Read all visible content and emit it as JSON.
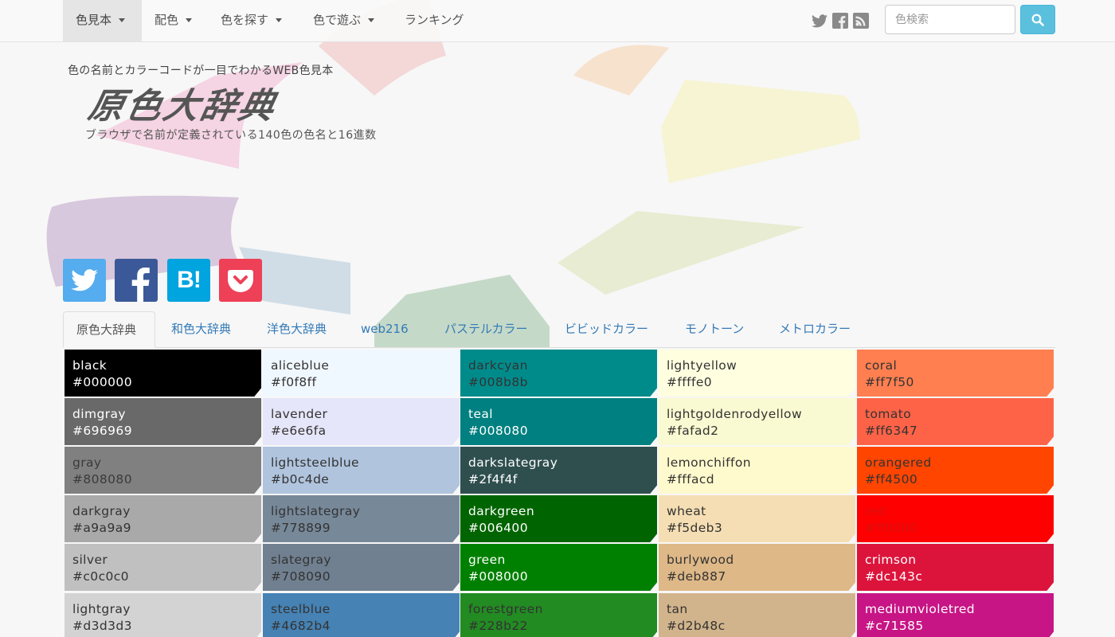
{
  "navbar": {
    "items": [
      {
        "label": "色見本",
        "dropdown": true,
        "active": true
      },
      {
        "label": "配色",
        "dropdown": true
      },
      {
        "label": "色を探す",
        "dropdown": true
      },
      {
        "label": "色で遊ぶ",
        "dropdown": true
      },
      {
        "label": "ランキング",
        "dropdown": false
      }
    ],
    "social_icons": [
      "twitter-icon",
      "facebook-icon",
      "rss-icon"
    ],
    "search": {
      "placeholder": "色検索",
      "button_icon": "search-icon"
    }
  },
  "header": {
    "tagline": "色の名前とカラーコードが一目でわかるWEB色見本",
    "title": "原色大辞典",
    "subtitle": "ブラウザで名前が定義されている140色の色名と16進数"
  },
  "share_buttons": [
    {
      "icon": "twitter-icon",
      "color": "#55acee"
    },
    {
      "icon": "facebook-icon",
      "color": "#3b5998"
    },
    {
      "icon": "hatena-bookmark-icon",
      "label": "B!",
      "color": "#00a4de"
    },
    {
      "icon": "pocket-icon",
      "color": "#ee4056"
    }
  ],
  "tabs": [
    {
      "label": "原色大辞典",
      "active": true
    },
    {
      "label": "和色大辞典"
    },
    {
      "label": "洋色大辞典"
    },
    {
      "label": "web216"
    },
    {
      "label": "パステルカラー"
    },
    {
      "label": "ビビッドカラー"
    },
    {
      "label": "モノトーン"
    },
    {
      "label": "メトロカラー"
    }
  ],
  "colors": [
    [
      {
        "name": "black",
        "hex": "#000000",
        "text": "#ffffff"
      },
      {
        "name": "dimgray",
        "hex": "#696969",
        "text": "#ffffff"
      },
      {
        "name": "gray",
        "hex": "#808080",
        "text": "#3a3a3a"
      },
      {
        "name": "darkgray",
        "hex": "#a9a9a9",
        "text": "#333333"
      },
      {
        "name": "silver",
        "hex": "#c0c0c0",
        "text": "#333333"
      },
      {
        "name": "lightgray",
        "hex": "#d3d3d3",
        "text": "#333333"
      }
    ],
    [
      {
        "name": "aliceblue",
        "hex": "#f0f8ff",
        "text": "#333333"
      },
      {
        "name": "lavender",
        "hex": "#e6e6fa",
        "text": "#333333"
      },
      {
        "name": "lightsteelblue",
        "hex": "#b0c4de",
        "text": "#333333"
      },
      {
        "name": "lightslategray",
        "hex": "#778899",
        "text": "#333333"
      },
      {
        "name": "slategray",
        "hex": "#708090",
        "text": "#333333"
      },
      {
        "name": "steelblue",
        "hex": "#4682b4",
        "text": "#333333"
      }
    ],
    [
      {
        "name": "darkcyan",
        "hex": "#008b8b",
        "text": "#333333"
      },
      {
        "name": "teal",
        "hex": "#008080",
        "text": "#ffffff"
      },
      {
        "name": "darkslategray",
        "hex": "#2f4f4f",
        "text": "#ffffff"
      },
      {
        "name": "darkgreen",
        "hex": "#006400",
        "text": "#ffffff"
      },
      {
        "name": "green",
        "hex": "#008000",
        "text": "#ffffff"
      },
      {
        "name": "forestgreen",
        "hex": "#228b22",
        "text": "#333333"
      }
    ],
    [
      {
        "name": "lightyellow",
        "hex": "#ffffe0",
        "text": "#333333"
      },
      {
        "name": "lightgoldenrodyellow",
        "hex": "#fafad2",
        "text": "#333333"
      },
      {
        "name": "lemonchiffon",
        "hex": "#fffacd",
        "text": "#333333"
      },
      {
        "name": "wheat",
        "hex": "#f5deb3",
        "text": "#333333"
      },
      {
        "name": "burlywood",
        "hex": "#deb887",
        "text": "#333333"
      },
      {
        "name": "tan",
        "hex": "#d2b48c",
        "text": "#333333"
      }
    ],
    [
      {
        "name": "coral",
        "hex": "#ff7f50",
        "text": "#333333"
      },
      {
        "name": "tomato",
        "hex": "#ff6347",
        "text": "#333333"
      },
      {
        "name": "orangered",
        "hex": "#ff4500",
        "text": "#333333"
      },
      {
        "name": "red",
        "hex": "#ff0000",
        "text": "#d81010"
      },
      {
        "name": "crimson",
        "hex": "#dc143c",
        "text": "#ffffff"
      },
      {
        "name": "mediumvioletred",
        "hex": "#c71585",
        "text": "#ffffff"
      }
    ]
  ]
}
